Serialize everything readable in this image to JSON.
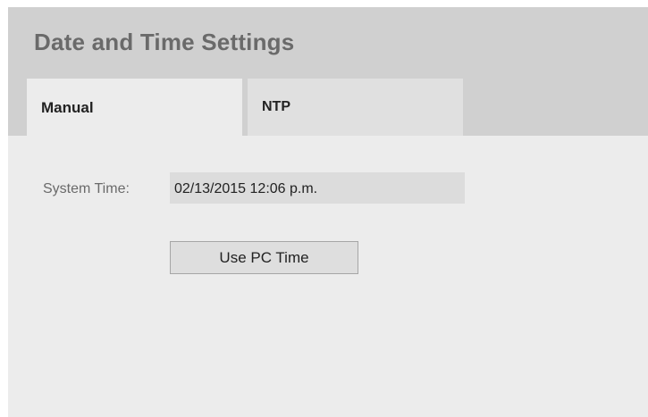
{
  "header": {
    "title": "Date and Time Settings"
  },
  "tabs": [
    {
      "label": "Manual",
      "active": true
    },
    {
      "label": "NTP",
      "active": false
    }
  ],
  "manual": {
    "system_time_label": "System Time:",
    "system_time_value": "02/13/2015 12:06 p.m.",
    "use_pc_time_label": "Use PC Time"
  },
  "colors": {
    "header_bg": "#d0d0d0",
    "panel_bg": "#ececec",
    "title_text": "#6a6a6a",
    "field_bg": "#dcdcdc"
  }
}
